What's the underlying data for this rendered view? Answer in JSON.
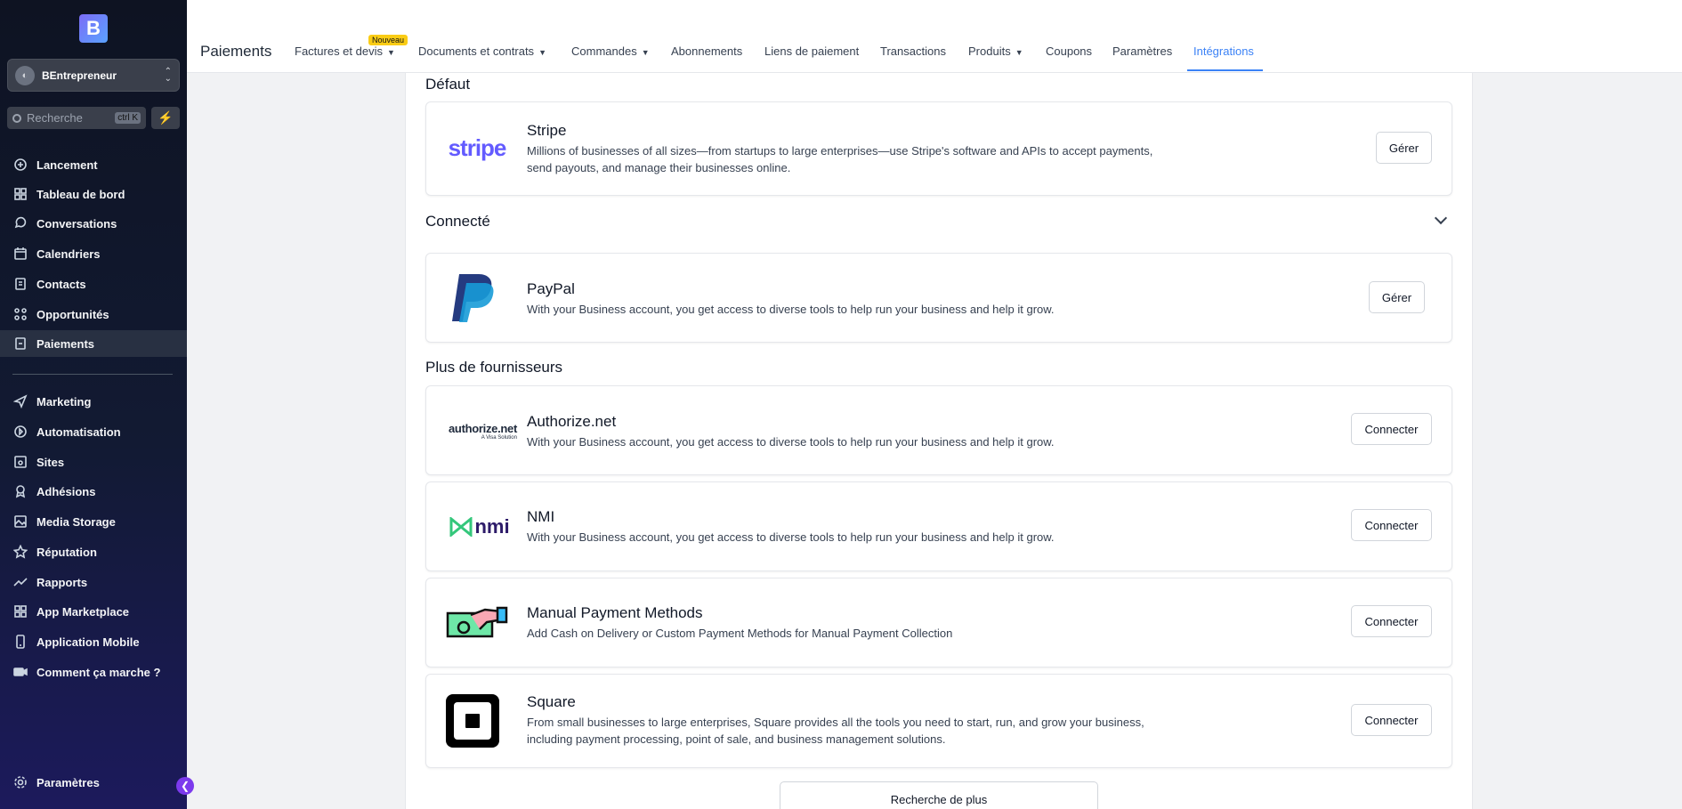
{
  "sidebar": {
    "logo_letter": "B",
    "account_name": "BEntrepreneur",
    "search_placeholder": "Recherche",
    "search_shortcut": "ctrl K",
    "items": [
      {
        "label": "Lancement",
        "icon": "rocket-icon"
      },
      {
        "label": "Tableau de bord",
        "icon": "dashboard-icon"
      },
      {
        "label": "Conversations",
        "icon": "chat-icon"
      },
      {
        "label": "Calendriers",
        "icon": "calendar-icon"
      },
      {
        "label": "Contacts",
        "icon": "contacts-icon"
      },
      {
        "label": "Opportunités",
        "icon": "opportunities-icon"
      },
      {
        "label": "Paiements",
        "icon": "payments-icon"
      },
      {
        "label": "Marketing",
        "icon": "send-icon"
      },
      {
        "label": "Automatisation",
        "icon": "automation-icon"
      },
      {
        "label": "Sites",
        "icon": "sites-icon"
      },
      {
        "label": "Adhésions",
        "icon": "memberships-icon"
      },
      {
        "label": "Media Storage",
        "icon": "image-icon"
      },
      {
        "label": "Réputation",
        "icon": "star-icon"
      },
      {
        "label": "Rapports",
        "icon": "chart-icon"
      },
      {
        "label": "App Marketplace",
        "icon": "apps-icon"
      },
      {
        "label": "Application Mobile",
        "icon": "mobile-icon"
      },
      {
        "label": "Comment ça marche ?",
        "icon": "video-icon"
      }
    ],
    "settings_label": "Paramètres"
  },
  "header": {
    "title": "Paiements",
    "new_badge": "Nouveau",
    "tabs": [
      {
        "label": "Factures et devis",
        "dropdown": true
      },
      {
        "label": "Documents et contrats",
        "dropdown": true
      },
      {
        "label": "Commandes",
        "dropdown": true
      },
      {
        "label": "Abonnements",
        "dropdown": false
      },
      {
        "label": "Liens de paiement",
        "dropdown": false
      },
      {
        "label": "Transactions",
        "dropdown": false
      },
      {
        "label": "Produits",
        "dropdown": true
      },
      {
        "label": "Coupons",
        "dropdown": false
      },
      {
        "label": "Paramètres",
        "dropdown": false
      },
      {
        "label": "Intégrations",
        "dropdown": false,
        "active": true
      }
    ]
  },
  "sections": {
    "default_label": "Défaut",
    "connected_label": "Connecté",
    "more_label": "Plus de fournisseurs"
  },
  "providers": {
    "stripe": {
      "name": "Stripe",
      "logo_text": "stripe",
      "desc": "Millions of businesses of all sizes—from startups to large enterprises—use Stripe's software and APIs to accept payments, send payouts, and manage their businesses online.",
      "button": "Gérer"
    },
    "paypal": {
      "name": "PayPal",
      "desc": "With your Business account, you get access to diverse tools to help run your business and help it grow.",
      "button": "Gérer"
    },
    "authorize": {
      "name": "Authorize.net",
      "logo_text": "authorize.net",
      "logo_sub": "A Visa Solution",
      "desc": "With your Business account, you get access to diverse tools to help run your business and help it grow.",
      "button": "Connecter"
    },
    "nmi": {
      "name": "NMI",
      "logo_text": "nmi",
      "desc": "With your Business account, you get access to diverse tools to help run your business and help it grow.",
      "button": "Connecter"
    },
    "manual": {
      "name": "Manual Payment Methods",
      "desc": "Add Cash on Delivery or Custom Payment Methods for Manual Payment Collection",
      "button": "Connecter"
    },
    "square": {
      "name": "Square",
      "desc": "From small businesses to large enterprises, Square provides all the tools you need to start, run, and grow your business, including payment processing, point of sale, and business management solutions.",
      "button": "Connecter"
    }
  },
  "more_button": "Recherche de plus",
  "colors": {
    "accent": "#3b82f6",
    "stripe": "#635bff",
    "paypal_dark": "#253b80",
    "paypal_light": "#179bd7",
    "nmi_green": "#34c77b",
    "nmi_purple": "#2d1b69"
  }
}
